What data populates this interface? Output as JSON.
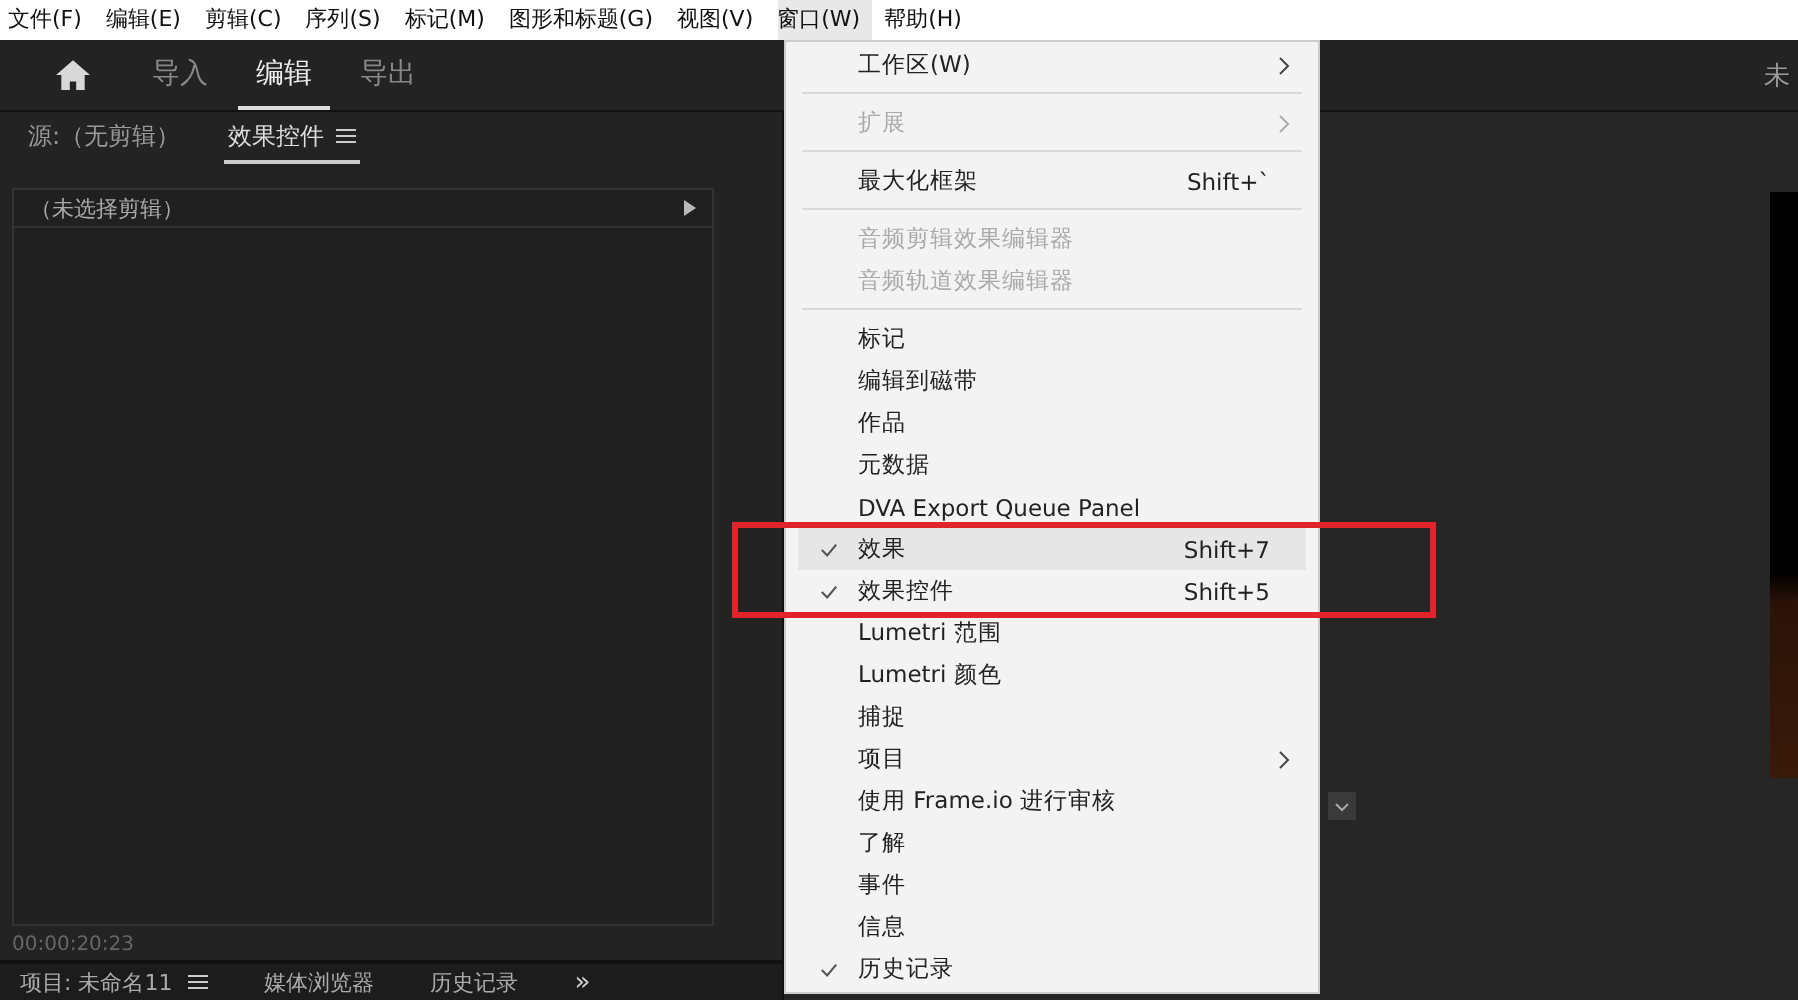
{
  "menubar": [
    {
      "label": "文件(F)",
      "selected": false
    },
    {
      "label": "编辑(E)",
      "selected": false
    },
    {
      "label": "剪辑(C)",
      "selected": false
    },
    {
      "label": "序列(S)",
      "selected": false
    },
    {
      "label": "标记(M)",
      "selected": false
    },
    {
      "label": "图形和标题(G)",
      "selected": false
    },
    {
      "label": "视图(V)",
      "selected": false
    },
    {
      "label": "窗口(W)",
      "selected": true
    },
    {
      "label": "帮助(H)",
      "selected": false
    }
  ],
  "workspace_tabs": [
    {
      "label": "导入",
      "selected": false
    },
    {
      "label": "编辑",
      "selected": true
    },
    {
      "label": "导出",
      "selected": false
    }
  ],
  "project_title": "未",
  "panel_tabs": [
    {
      "label": "源:（无剪辑）",
      "selected": false,
      "menu": false
    },
    {
      "label": "效果控件",
      "selected": true,
      "menu": true
    }
  ],
  "panel_header": "（未选择剪辑）",
  "timecode": "00:00:20:23",
  "bottom_tabs": [
    {
      "label": "项目: 未命名11",
      "menu": true
    },
    {
      "label": "媒体浏览器",
      "menu": false
    },
    {
      "label": "历史记录",
      "menu": false
    }
  ],
  "bottom_more": "»",
  "window_menu": [
    {
      "kind": "item",
      "label": "工作区(W)",
      "submenu": true,
      "disabled": false,
      "checked": false,
      "hovered": false
    },
    {
      "kind": "separator"
    },
    {
      "kind": "item",
      "label": "扩展",
      "submenu": true,
      "disabled": true,
      "checked": false,
      "hovered": false
    },
    {
      "kind": "separator"
    },
    {
      "kind": "item",
      "label": "最大化框架",
      "shortcut": "Shift+`",
      "submenu": false,
      "disabled": false,
      "checked": false,
      "hovered": false
    },
    {
      "kind": "separator"
    },
    {
      "kind": "item",
      "label": "音频剪辑效果编辑器",
      "submenu": false,
      "disabled": true,
      "checked": false,
      "hovered": false
    },
    {
      "kind": "item",
      "label": "音频轨道效果编辑器",
      "submenu": false,
      "disabled": true,
      "checked": false,
      "hovered": false
    },
    {
      "kind": "separator"
    },
    {
      "kind": "item",
      "label": "标记",
      "submenu": false,
      "disabled": false,
      "checked": false,
      "hovered": false
    },
    {
      "kind": "item",
      "label": "编辑到磁带",
      "submenu": false,
      "disabled": false,
      "checked": false,
      "hovered": false
    },
    {
      "kind": "item",
      "label": "作品",
      "submenu": false,
      "disabled": false,
      "checked": false,
      "hovered": false
    },
    {
      "kind": "item",
      "label": "元数据",
      "submenu": false,
      "disabled": false,
      "checked": false,
      "hovered": false
    },
    {
      "kind": "item",
      "label": "DVA Export Queue Panel",
      "submenu": false,
      "disabled": false,
      "checked": false,
      "hovered": false
    },
    {
      "kind": "highlight",
      "items": [
        {
          "label": "效果",
          "shortcut": "Shift+7",
          "submenu": false,
          "disabled": false,
          "checked": true,
          "hovered": true
        },
        {
          "label": "效果控件",
          "shortcut": "Shift+5",
          "submenu": false,
          "disabled": false,
          "checked": true,
          "hovered": false
        }
      ]
    },
    {
      "kind": "item",
      "label": "Lumetri 范围",
      "submenu": false,
      "disabled": false,
      "checked": false,
      "hovered": false
    },
    {
      "kind": "item",
      "label": "Lumetri 颜色",
      "submenu": false,
      "disabled": false,
      "checked": false,
      "hovered": false
    },
    {
      "kind": "item",
      "label": "捕捉",
      "submenu": false,
      "disabled": false,
      "checked": false,
      "hovered": false
    },
    {
      "kind": "item",
      "label": "项目",
      "submenu": true,
      "disabled": false,
      "checked": false,
      "hovered": false
    },
    {
      "kind": "item",
      "label": "使用 Frame.io 进行审核",
      "submenu": false,
      "disabled": false,
      "checked": false,
      "hovered": false
    },
    {
      "kind": "item",
      "label": "了解",
      "submenu": false,
      "disabled": false,
      "checked": false,
      "hovered": false
    },
    {
      "kind": "item",
      "label": "事件",
      "submenu": false,
      "disabled": false,
      "checked": false,
      "hovered": false
    },
    {
      "kind": "item",
      "label": "信息",
      "submenu": false,
      "disabled": false,
      "checked": false,
      "hovered": false
    },
    {
      "kind": "item",
      "label": "历史记录",
      "submenu": false,
      "disabled": false,
      "checked": true,
      "hovered": false
    }
  ]
}
